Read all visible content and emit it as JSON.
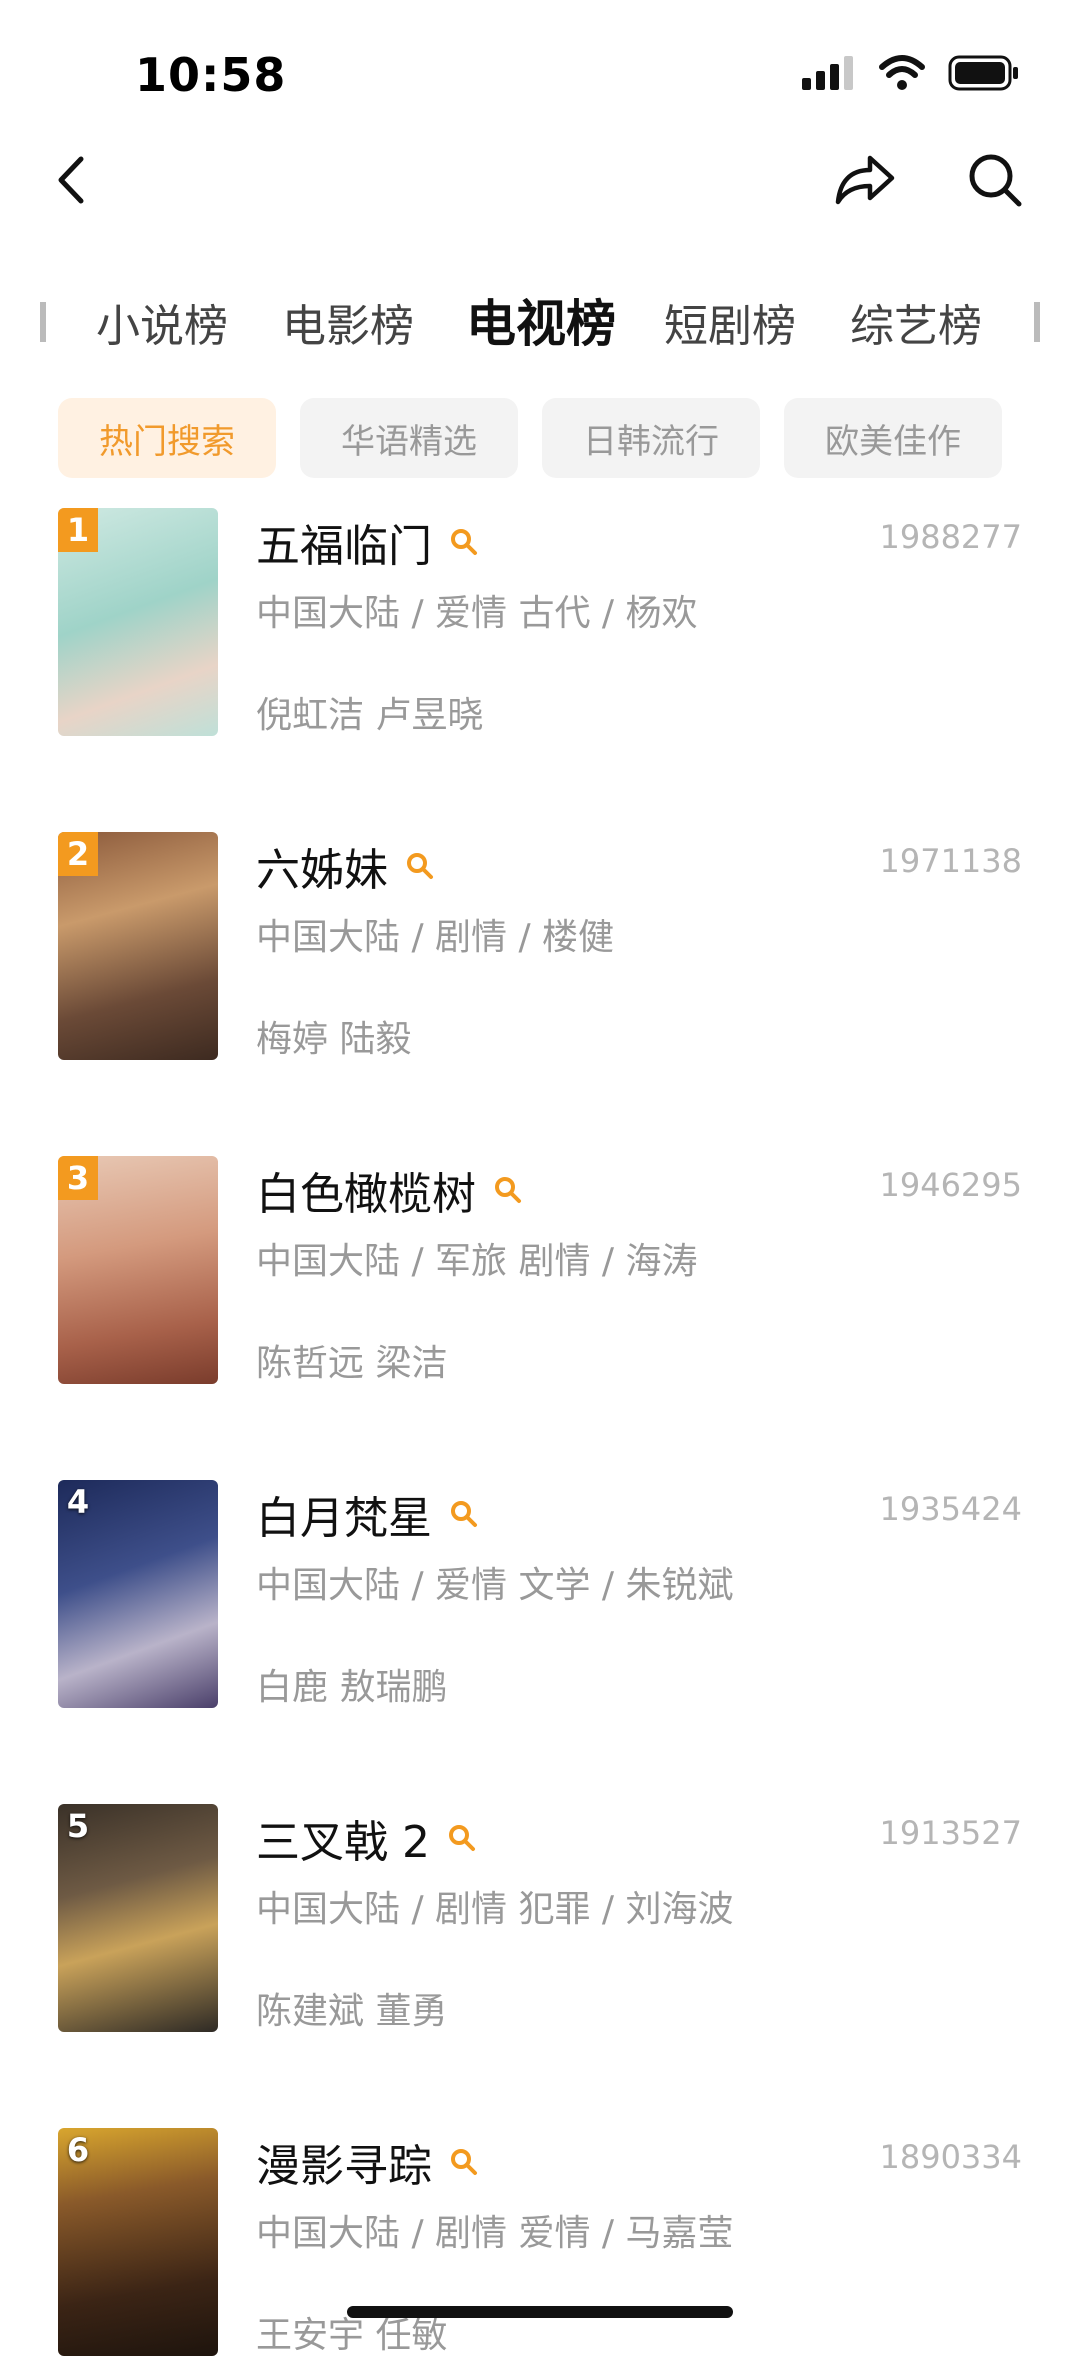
{
  "status": {
    "time": "10:58"
  },
  "tabs": [
    {
      "label": "小说榜",
      "active": false
    },
    {
      "label": "电影榜",
      "active": false
    },
    {
      "label": "电视榜",
      "active": true
    },
    {
      "label": "短剧榜",
      "active": false
    },
    {
      "label": "综艺榜",
      "active": false
    }
  ],
  "chips": [
    {
      "label": "热门搜索",
      "active": true
    },
    {
      "label": "华语精选",
      "active": false
    },
    {
      "label": "日韩流行",
      "active": false
    },
    {
      "label": "欧美佳作",
      "active": false
    }
  ],
  "items": [
    {
      "rank": "1",
      "title": "五福临门",
      "score": "1988277",
      "meta": "中国大陆 / 爱情 古代 / 杨欢",
      "cast": "倪虹洁 卢昱晓"
    },
    {
      "rank": "2",
      "title": "六姊妹",
      "score": "1971138",
      "meta": "中国大陆 / 剧情 / 楼健",
      "cast": "梅婷 陆毅"
    },
    {
      "rank": "3",
      "title": "白色橄榄树",
      "score": "1946295",
      "meta": "中国大陆 / 军旅 剧情 / 海涛",
      "cast": "陈哲远 梁洁"
    },
    {
      "rank": "4",
      "title": "白月梵星",
      "score": "1935424",
      "meta": "中国大陆 / 爱情 文学 / 朱锐斌",
      "cast": "白鹿 敖瑞鹏"
    },
    {
      "rank": "5",
      "title": "三叉戟 2",
      "score": "1913527",
      "meta": "中国大陆 / 剧情 犯罪 / 刘海波",
      "cast": "陈建斌 董勇"
    },
    {
      "rank": "6",
      "title": "漫影寻踪",
      "score": "1890334",
      "meta": "中国大陆 / 剧情 爱情 / 马嘉莹",
      "cast": "王安宇 任敏"
    }
  ],
  "colors": {
    "accent": "#f39a1f",
    "chip_active_bg": "#fff1e2",
    "muted": "#999999"
  },
  "icons": [
    "back-icon",
    "share-icon",
    "search-icon",
    "signal-icon",
    "wifi-icon",
    "battery-icon",
    "magnifier-badge-icon"
  ]
}
